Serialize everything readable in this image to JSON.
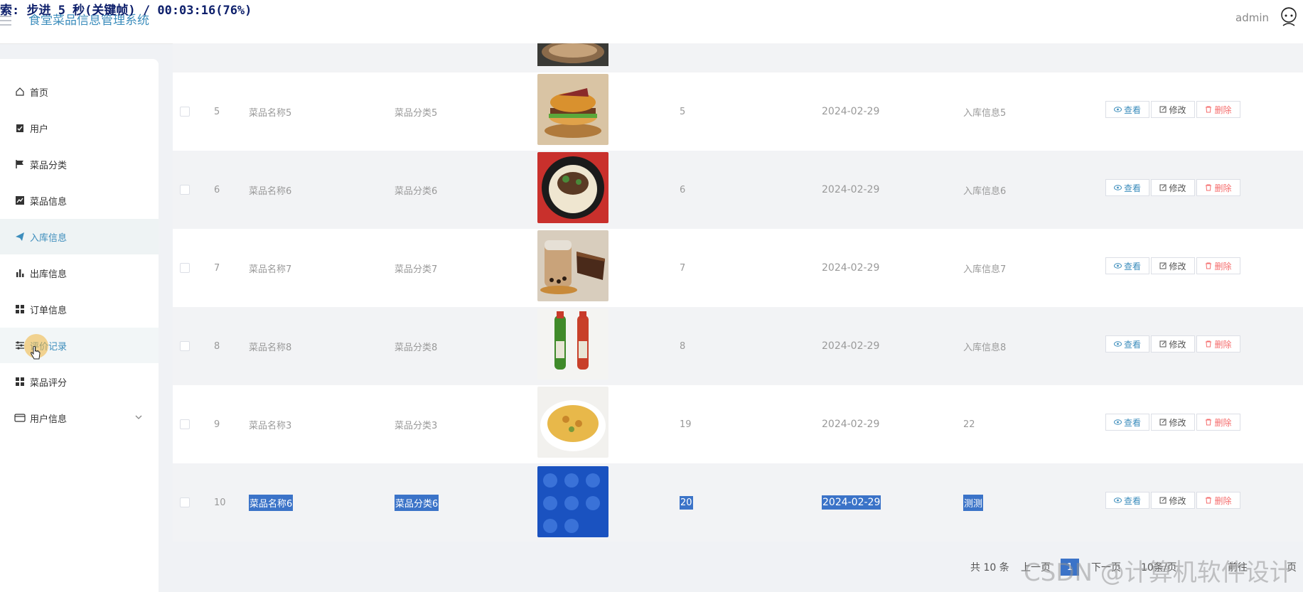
{
  "overlay": {
    "caption": "索: 步进 5 秒(关键帧) / 00:03:16(76%)"
  },
  "header": {
    "title": "食堂菜品信息管理系统",
    "user": "admin"
  },
  "sidebar": {
    "items": [
      {
        "label": "首页",
        "icon": "home-icon"
      },
      {
        "label": "用户",
        "icon": "clipboard-check-icon"
      },
      {
        "label": "菜品分类",
        "icon": "flag-icon"
      },
      {
        "label": "菜品信息",
        "icon": "line-chart-icon"
      },
      {
        "label": "入库信息",
        "icon": "paper-plane-icon"
      },
      {
        "label": "出库信息",
        "icon": "bar-chart-icon"
      },
      {
        "label": "订单信息",
        "icon": "grid-icon"
      },
      {
        "label": "评价记录",
        "icon": "sliders-icon"
      },
      {
        "label": "菜品评分",
        "icon": "grid-icon"
      },
      {
        "label": "用户信息",
        "icon": "id-card-icon"
      }
    ]
  },
  "table": {
    "rows": [
      {
        "index": "5",
        "name": "菜品名称5",
        "category": "菜品分类5",
        "qty": "5",
        "date": "2024-02-29",
        "info": "入库信息5"
      },
      {
        "index": "6",
        "name": "菜品名称6",
        "category": "菜品分类6",
        "qty": "6",
        "date": "2024-02-29",
        "info": "入库信息6"
      },
      {
        "index": "7",
        "name": "菜品名称7",
        "category": "菜品分类7",
        "qty": "7",
        "date": "2024-02-29",
        "info": "入库信息7"
      },
      {
        "index": "8",
        "name": "菜品名称8",
        "category": "菜品分类8",
        "qty": "8",
        "date": "2024-02-29",
        "info": "入库信息8"
      },
      {
        "index": "9",
        "name": "菜品名称3",
        "category": "菜品分类3",
        "qty": "19",
        "date": "2024-02-29",
        "info": "22"
      },
      {
        "index": "10",
        "name": "菜品名称6",
        "category": "菜品分类6",
        "qty": "20",
        "date": "2024-02-29",
        "info": "测测"
      }
    ],
    "actions": {
      "view": "查看",
      "edit": "修改",
      "delete": "删除"
    }
  },
  "pagination": {
    "total": "共 10 条",
    "prev": "上一页",
    "current": "1",
    "next": "下一页",
    "page_size": "10条/页",
    "goto": "前往",
    "page_unit": "页"
  },
  "watermark": "CSDN @计算机软件设计",
  "colors": {
    "accent": "#3c8dbc",
    "danger": "#f56c6c",
    "selection": "#3b73c8"
  }
}
